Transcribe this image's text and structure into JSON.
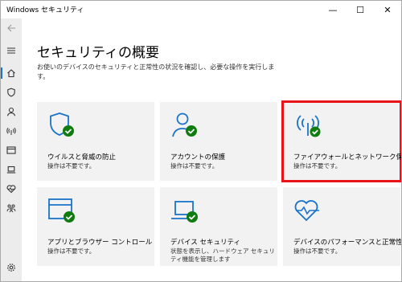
{
  "window": {
    "title": "Windows セキュリティ",
    "minimize": "—",
    "maximize": "☐",
    "close": "✕"
  },
  "rail": {
    "items": [
      {
        "name": "back-arrow-icon"
      },
      {
        "name": "hamburger-menu-icon"
      },
      {
        "name": "home-icon"
      },
      {
        "name": "shield-icon"
      },
      {
        "name": "person-icon"
      },
      {
        "name": "wireless-icon"
      },
      {
        "name": "app-browser-icon"
      },
      {
        "name": "laptop-icon"
      },
      {
        "name": "heart-pulse-icon"
      },
      {
        "name": "family-icon"
      },
      {
        "name": "gear-icon"
      }
    ]
  },
  "main": {
    "title": "セキュリティの概要",
    "description": "お使いのデバイスのセキュリティと正常性の状況を確認し、必要な操作を実行します。",
    "tiles": [
      {
        "title": "ウイルスと脅威の防止",
        "status": "操作は不要です。"
      },
      {
        "title": "アカウントの保護",
        "status": "操作は不要です。"
      },
      {
        "title": "ファイアウォールとネットワーク保護",
        "status": "操作は不要です。"
      },
      {
        "title": "アプリとブラウザー コントロール",
        "status": "操作は不要です。"
      },
      {
        "title": "デバイス セキュリティ",
        "status": "状態を表示し、ハードウェア セキュリティ機能を管理します"
      },
      {
        "title": "デバイスのパフォーマンスと正常性",
        "status": "操作は不要です。"
      }
    ]
  },
  "colors": {
    "accent_blue": "#1a73c8",
    "check_green": "#107c10",
    "highlight_red": "#e8141a"
  }
}
